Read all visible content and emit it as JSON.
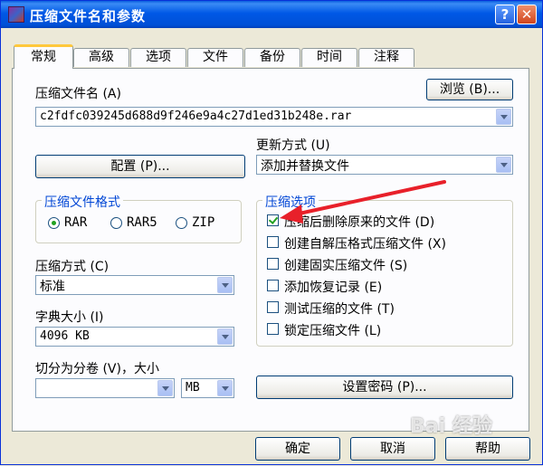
{
  "window": {
    "title": "压缩文件名和参数",
    "help_glyph": "?",
    "close_glyph": "✕"
  },
  "tabs": [
    "常规",
    "高级",
    "选项",
    "文件",
    "备份",
    "时间",
    "注释"
  ],
  "archive_name": {
    "label": "压缩文件名 (A)",
    "value": "c2fdfc039245d688d9f246e9a4c27d1ed31b248e.rar",
    "browse_button": "浏览 (B)..."
  },
  "profiles_button": "配置 (P)...",
  "update_mode": {
    "label": "更新方式 (U)",
    "value": "添加并替换文件"
  },
  "archive_format": {
    "title": "压缩文件格式",
    "options": [
      {
        "label": "RAR",
        "selected": true
      },
      {
        "label": "RAR5",
        "selected": false
      },
      {
        "label": "ZIP",
        "selected": false
      }
    ]
  },
  "compression_method": {
    "label": "压缩方式 (C)",
    "value": "标准"
  },
  "dictionary_size": {
    "label": "字典大小 (I)",
    "value": "4096 KB"
  },
  "split_volumes": {
    "label": "切分为分卷 (V)，大小",
    "value": "",
    "unit": "MB"
  },
  "archive_options": {
    "title": "压缩选项",
    "items": [
      {
        "label": "压缩后删除原来的文件 (D)",
        "checked": true
      },
      {
        "label": "创建自解压格式压缩文件 (X)",
        "checked": false
      },
      {
        "label": "创建固实压缩文件 (S)",
        "checked": false
      },
      {
        "label": "添加恢复记录 (E)",
        "checked": false
      },
      {
        "label": "测试压缩的文件 (T)",
        "checked": false
      },
      {
        "label": "锁定压缩文件 (L)",
        "checked": false
      }
    ]
  },
  "set_password_button": "设置密码 (P)...",
  "footer": {
    "ok": "确定",
    "cancel": "取消",
    "help": "帮助"
  },
  "watermark": "Bai 经验",
  "colors": {
    "annotation_arrow": "#e8202a",
    "title_bar": "#0058e6",
    "group_label": "#0046d5"
  }
}
